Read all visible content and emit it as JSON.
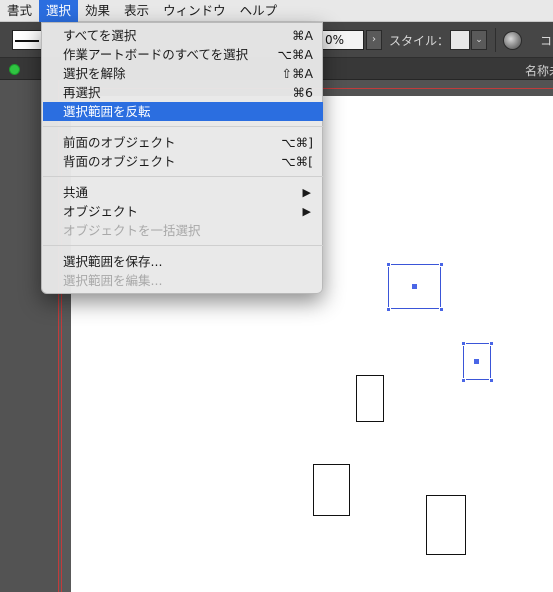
{
  "menubar": {
    "items": [
      {
        "label": "書式"
      },
      {
        "label": "選択",
        "active": true
      },
      {
        "label": "効果"
      },
      {
        "label": "表示"
      },
      {
        "label": "ウィンドウ"
      },
      {
        "label": "ヘルプ"
      }
    ]
  },
  "controlbar": {
    "opacity_value": "0%",
    "opacity_arrow": "›",
    "style_label": "スタイル：",
    "style_arrow": "⌄",
    "cut_label": "コ"
  },
  "document": {
    "name_fragment": "名称未"
  },
  "select_menu": {
    "items": [
      {
        "label": "すべてを選択",
        "shortcut": "⌘A"
      },
      {
        "label": "作業アートボードのすべてを選択",
        "shortcut": "⌥⌘A"
      },
      {
        "label": "選択を解除",
        "shortcut": "⇧⌘A"
      },
      {
        "label": "再選択",
        "shortcut": "⌘6"
      },
      {
        "label": "選択範囲を反転",
        "shortcut": ""
      },
      {
        "label": "前面のオブジェクト",
        "shortcut": "⌥⌘]"
      },
      {
        "label": "背面のオブジェクト",
        "shortcut": "⌥⌘["
      },
      {
        "label": "共通",
        "submenu": "▶"
      },
      {
        "label": "オブジェクト",
        "submenu": "▶"
      },
      {
        "label": "オブジェクトを一括選択",
        "disabled": true
      },
      {
        "label": "選択範囲を保存..."
      },
      {
        "label": "選択範囲を編集...",
        "disabled": true
      }
    ]
  },
  "colors": {
    "selection_blue": "#3a55d8",
    "menu_highlight": "#2b6ee0",
    "bleed_red": "#c23b3b"
  }
}
